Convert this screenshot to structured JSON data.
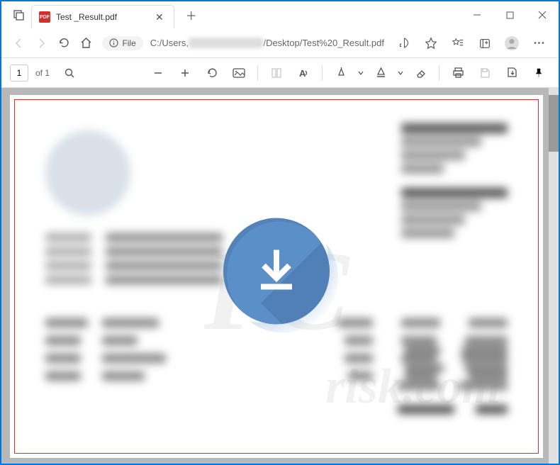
{
  "window": {
    "tab_title": "Test _Result.pdf",
    "pdf_badge": "PDF"
  },
  "navbar": {
    "file_label": "File",
    "path_prefix": "C:/Users,",
    "path_suffix": "/Desktop/Test%20_Result.pdf"
  },
  "pdf_toolbar": {
    "current_page": "1",
    "page_of_label": "of 1"
  },
  "watermark": {
    "main": "PC",
    "sub": "risk.com"
  }
}
